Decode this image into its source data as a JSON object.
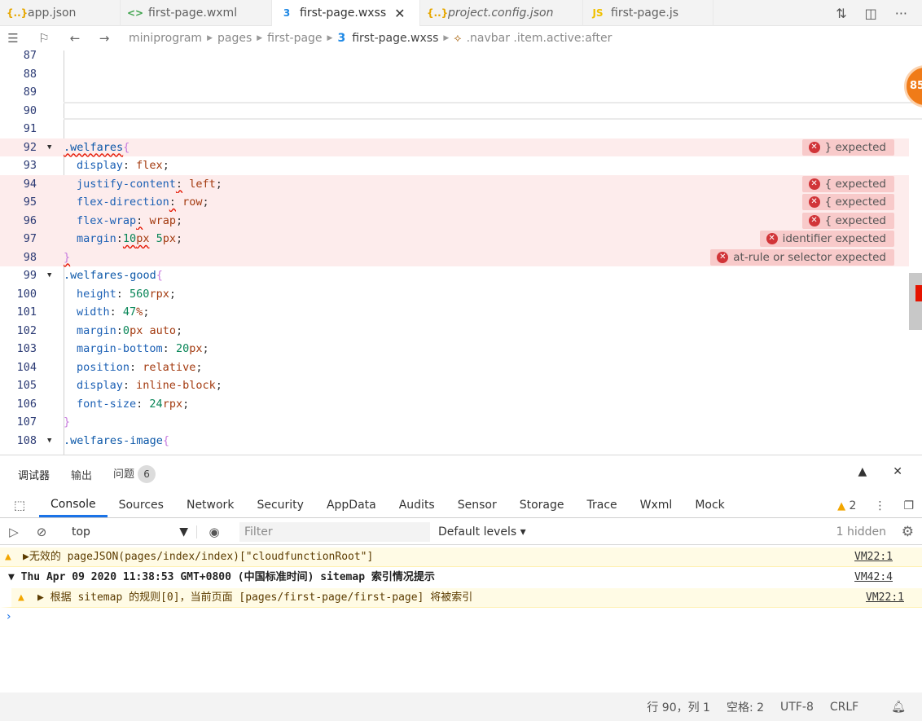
{
  "tabs": [
    {
      "label": "app.json",
      "icon": "{..}",
      "color": "#e6a700",
      "active": false
    },
    {
      "label": "first-page.wxml",
      "icon": "<>",
      "color": "#3fa34d",
      "active": false
    },
    {
      "label": "first-page.wxss",
      "icon": "3",
      "color": "#1e88e5",
      "active": true
    },
    {
      "label": "project.config.json",
      "icon": "{..}",
      "color": "#e6a700",
      "active": false
    },
    {
      "label": "first-page.js",
      "icon": "JS",
      "color": "#f0c000",
      "active": false
    }
  ],
  "breadcrumb": {
    "parts": [
      "miniprogram",
      "pages",
      "first-page"
    ],
    "file": "first-page.wxss",
    "symbol": ".navbar .item.active:after"
  },
  "editor": {
    "lines": [
      {
        "n": "87"
      },
      {
        "n": "88"
      },
      {
        "n": "89"
      },
      {
        "n": "90"
      },
      {
        "n": "91"
      },
      {
        "n": "92",
        "sel": ".welfares",
        "err": "} expected"
      },
      {
        "n": "93",
        "prop": "display",
        "val": "flex"
      },
      {
        "n": "94",
        "prop": "justify-content",
        "val": "left",
        "err": "{ expected"
      },
      {
        "n": "95",
        "prop": "flex-direction",
        "val": "row",
        "err": "{ expected"
      },
      {
        "n": "96",
        "prop": "flex-wrap",
        "val": "wrap",
        "err": "{ expected"
      },
      {
        "n": "97",
        "prop": "margin",
        "num1": "10",
        "unit1": "px",
        "num2": "5",
        "unit2": "px",
        "err": "identifier expected"
      },
      {
        "n": "98",
        "close": "}",
        "err": "at-rule or selector expected"
      },
      {
        "n": "99",
        "sel": ".welfares-good"
      },
      {
        "n": "100",
        "prop": "height",
        "num1": "560",
        "unit1": "rpx"
      },
      {
        "n": "101",
        "prop": "width",
        "num1": "47",
        "unit1": "%"
      },
      {
        "n": "102",
        "prop": "margin",
        "num1": "0",
        "unit1": "px",
        "rest": "auto"
      },
      {
        "n": "103",
        "prop": "margin-bottom",
        "num1": "20",
        "unit1": "px"
      },
      {
        "n": "104",
        "prop": "position",
        "val": "relative"
      },
      {
        "n": "105",
        "prop": "display",
        "val": "inline-block"
      },
      {
        "n": "106",
        "prop": "font-size",
        "num1": "24",
        "unit1": "rpx"
      },
      {
        "n": "107",
        "close": "}"
      },
      {
        "n": "108",
        "sel": ".welfares-image"
      }
    ],
    "minimap_badge": "85"
  },
  "panel": {
    "tabs": [
      "调试器",
      "输出",
      "问题"
    ],
    "problem_count": "6",
    "devtools_tabs": [
      "Console",
      "Sources",
      "Network",
      "Security",
      "AppData",
      "Audits",
      "Sensor",
      "Storage",
      "Trace",
      "Wxml",
      "Mock"
    ],
    "warning_count": "2",
    "context": "top",
    "filter_placeholder": "Filter",
    "levels": "Default levels",
    "hidden": "1 hidden",
    "messages": [
      {
        "text": "▶无效的 pageJSON(pages/index/index)[\"cloudfunctionRoot\"]",
        "src": "VM22:1"
      },
      {
        "text": "▼ Thu Apr 09 2020 11:38:53 GMT+0800 (中国标准时间) sitemap 索引情况提示",
        "src": "VM42:4"
      },
      {
        "text": "▶ 根据 sitemap 的规则[0]，当前页面 [pages/first-page/first-page] 将被索引",
        "src": "VM22:1"
      }
    ]
  },
  "status": {
    "position": "行 90，列 1",
    "spaces": "空格: 2",
    "encoding": "UTF-8",
    "eol": "CRLF"
  }
}
